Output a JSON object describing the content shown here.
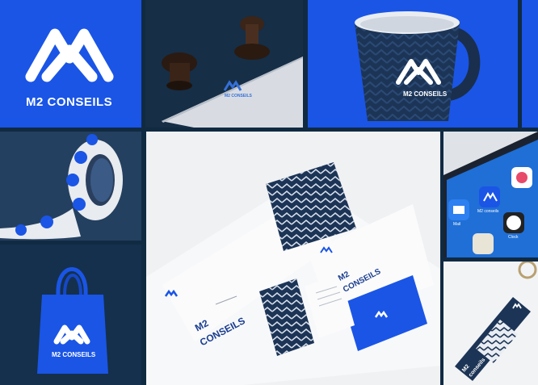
{
  "brand": {
    "name_upper": "M2 CONSEILS",
    "name_lower": "M2 conseils",
    "name_split_1": "M2",
    "name_split_2": "CONSEILS",
    "name_split_2_lower": "conseils"
  },
  "phone": {
    "apps": [
      "Mail",
      "M2 conseils",
      "Clock"
    ]
  },
  "colors": {
    "royal_blue": "#1a55e6",
    "navy": "#102a42",
    "dark_navy": "#0e2238",
    "paper": "#f2f3f5"
  },
  "icons": [
    "m2-logo-icon",
    "stamp-icon",
    "mug-icon",
    "tape-roll-icon",
    "tote-bag-icon",
    "envelope-icon",
    "business-card-icon",
    "phone-icon",
    "keychain-icon"
  ]
}
